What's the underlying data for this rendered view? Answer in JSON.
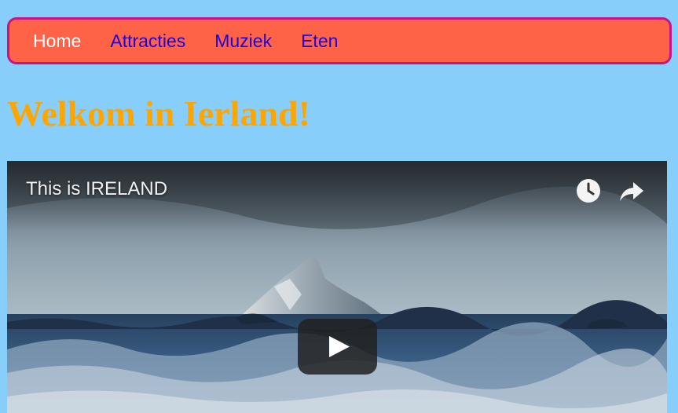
{
  "nav": {
    "items": [
      {
        "label": "Home",
        "active": true
      },
      {
        "label": "Attracties",
        "active": false
      },
      {
        "label": "Muziek",
        "active": false
      },
      {
        "label": "Eten",
        "active": false
      }
    ]
  },
  "page": {
    "title": "Welkom in Ierland!"
  },
  "video": {
    "title": "This is IRELAND",
    "controls": {
      "watch_later_icon": "clock-icon",
      "share_icon": "share-arrow-icon",
      "play_icon": "play-button-icon"
    }
  },
  "colors": {
    "page_background": "#87cefa",
    "nav_background": "#ff6347",
    "nav_border": "#c71585",
    "nav_link": "#1e00d8",
    "nav_active_link": "#ffffff",
    "title": "#ffa500"
  }
}
